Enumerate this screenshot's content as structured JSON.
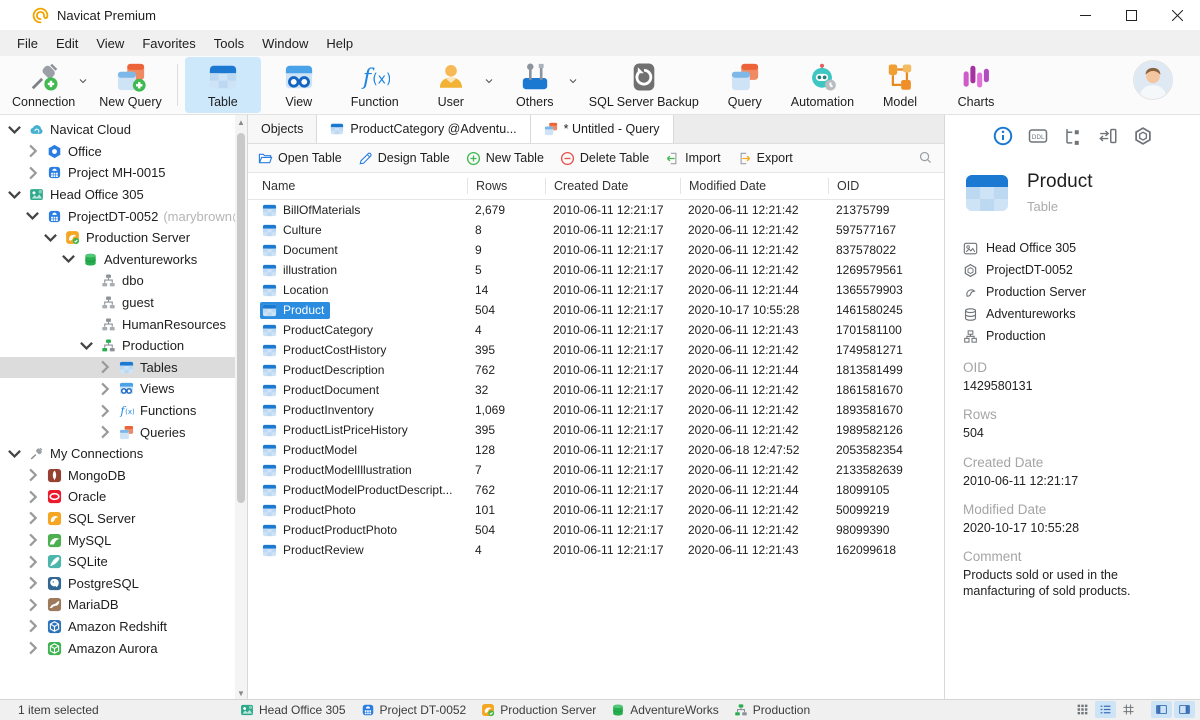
{
  "window": {
    "title": "Navicat Premium"
  },
  "menu": [
    "File",
    "Edit",
    "View",
    "Favorites",
    "Tools",
    "Window",
    "Help"
  ],
  "toolbar": {
    "items": [
      {
        "label": "Connection",
        "icon": "connection",
        "dropdown": true
      },
      {
        "label": "New Query",
        "icon": "new-query"
      },
      {
        "type": "separator"
      },
      {
        "label": "Table",
        "icon": "table",
        "active": true
      },
      {
        "label": "View",
        "icon": "view"
      },
      {
        "label": "Function",
        "icon": "function"
      },
      {
        "label": "User",
        "icon": "user",
        "dropdown": true
      },
      {
        "label": "Others",
        "icon": "others",
        "dropdown": true
      },
      {
        "label": "SQL Server Backup",
        "icon": "backup"
      },
      {
        "label": "Query",
        "icon": "query"
      },
      {
        "label": "Automation",
        "icon": "automation"
      },
      {
        "label": "Model",
        "icon": "model"
      },
      {
        "label": "Charts",
        "icon": "charts"
      }
    ]
  },
  "tabs": [
    {
      "label": "Objects",
      "active": true
    },
    {
      "label": "ProductCategory @Adventu...",
      "icon": "table"
    },
    {
      "label": "* Untitled - Query",
      "icon": "query"
    }
  ],
  "object_toolbar": [
    {
      "label": "Open Table",
      "icon": "open-table"
    },
    {
      "label": "Design Table",
      "icon": "design-table"
    },
    {
      "label": "New Table",
      "icon": "new-table"
    },
    {
      "label": "Delete Table",
      "icon": "delete-table"
    },
    {
      "label": "Import",
      "icon": "import"
    },
    {
      "label": "Export",
      "icon": "export"
    }
  ],
  "sidebar": {
    "items": [
      {
        "label": "Navicat Cloud",
        "icon": "cloud",
        "level": 0,
        "arrow": "open"
      },
      {
        "label": "Office",
        "icon": "office",
        "level": 1,
        "arrow": "closed"
      },
      {
        "label": "Project MH-0015",
        "icon": "project",
        "level": 1,
        "arrow": "closed"
      },
      {
        "label": "Head Office 305",
        "icon": "head-office",
        "level": 0,
        "arrow": "open"
      },
      {
        "label": "ProjectDT-0052",
        "suffix": "(marybrown@",
        "icon": "project",
        "level": 1,
        "arrow": "open"
      },
      {
        "label": "Production Server",
        "icon": "server",
        "level": 2,
        "arrow": "open"
      },
      {
        "label": "Adventureworks",
        "icon": "database",
        "level": 3,
        "arrow": "open"
      },
      {
        "label": "dbo",
        "icon": "schema",
        "level": 4,
        "arrow": "none"
      },
      {
        "label": "guest",
        "icon": "schema",
        "level": 4,
        "arrow": "none"
      },
      {
        "label": "HumanResources",
        "icon": "schema",
        "level": 4,
        "arrow": "none"
      },
      {
        "label": "Production",
        "icon": "schema-active",
        "level": 4,
        "arrow": "open"
      },
      {
        "label": "Tables",
        "icon": "table",
        "level": 5,
        "arrow": "closed",
        "selected": true
      },
      {
        "label": "Views",
        "icon": "view",
        "level": 5,
        "arrow": "closed"
      },
      {
        "label": "Functions",
        "icon": "function",
        "level": 5,
        "arrow": "closed"
      },
      {
        "label": "Queries",
        "icon": "query",
        "level": 5,
        "arrow": "closed"
      },
      {
        "label": "My Connections",
        "icon": "connections",
        "level": 0,
        "arrow": "open"
      },
      {
        "label": "MongoDB",
        "icon": "mongodb",
        "level": 1,
        "arrow": "closed"
      },
      {
        "label": "Oracle",
        "icon": "oracle",
        "level": 1,
        "arrow": "closed"
      },
      {
        "label": "SQL Server",
        "icon": "sqlserver",
        "level": 1,
        "arrow": "closed"
      },
      {
        "label": "MySQL",
        "icon": "mysql",
        "level": 1,
        "arrow": "closed"
      },
      {
        "label": "SQLite",
        "icon": "sqlite",
        "level": 1,
        "arrow": "closed"
      },
      {
        "label": "PostgreSQL",
        "icon": "postgresql",
        "level": 1,
        "arrow": "closed"
      },
      {
        "label": "MariaDB",
        "icon": "mariadb",
        "level": 1,
        "arrow": "closed"
      },
      {
        "label": "Amazon Redshift",
        "icon": "redshift",
        "level": 1,
        "arrow": "closed"
      },
      {
        "label": "Amazon Aurora",
        "icon": "aurora",
        "level": 1,
        "arrow": "closed"
      }
    ]
  },
  "table": {
    "columns": [
      "Name",
      "Rows",
      "Created Date",
      "Modified Date",
      "OID"
    ],
    "selected_index": 5,
    "rows": [
      [
        "BillOfMaterials",
        "2,679",
        "2010-06-11 12:21:17",
        "2020-06-11 12:21:42",
        "21375799"
      ],
      [
        "Culture",
        "8",
        "2010-06-11 12:21:17",
        "2020-06-11 12:21:42",
        "597577167"
      ],
      [
        "Document",
        "9",
        "2010-06-11 12:21:17",
        "2020-06-11 12:21:42",
        "837578022"
      ],
      [
        "illustration",
        "5",
        "2010-06-11 12:21:17",
        "2020-06-11 12:21:42",
        "1269579561"
      ],
      [
        "Location",
        "14",
        "2010-06-11 12:21:17",
        "2020-06-11 12:21:44",
        "1365579903"
      ],
      [
        "Product",
        "504",
        "2010-06-11 12:21:17",
        "2020-10-17 10:55:28",
        "1461580245"
      ],
      [
        "ProductCategory",
        "4",
        "2010-06-11 12:21:17",
        "2020-06-11 12:21:43",
        "1701581100"
      ],
      [
        "ProductCostHistory",
        "395",
        "2010-06-11 12:21:17",
        "2020-06-11 12:21:42",
        "1749581271"
      ],
      [
        "ProductDescription",
        "762",
        "2010-06-11 12:21:17",
        "2020-06-11 12:21:44",
        "1813581499"
      ],
      [
        "ProductDocument",
        "32",
        "2010-06-11 12:21:17",
        "2020-06-11 12:21:42",
        "1861581670"
      ],
      [
        "ProductInventory",
        "1,069",
        "2010-06-11 12:21:17",
        "2020-06-11 12:21:42",
        "1893581670"
      ],
      [
        "ProductListPriceHistory",
        "395",
        "2010-06-11 12:21:17",
        "2020-06-11 12:21:42",
        "1989582126"
      ],
      [
        "ProductModel",
        "128",
        "2010-06-11 12:21:17",
        "2020-06-18 12:47:52",
        "2053582354"
      ],
      [
        "ProductModelIllustration",
        "7",
        "2010-06-11 12:21:17",
        "2020-06-11 12:21:42",
        "2133582639"
      ],
      [
        "ProductModelProductDescript...",
        "762",
        "2010-06-11 12:21:17",
        "2020-06-11 12:21:44",
        "18099105"
      ],
      [
        "ProductPhoto",
        "101",
        "2010-06-11 12:21:17",
        "2020-06-11 12:21:42",
        "50099219"
      ],
      [
        "ProductProductPhoto",
        "504",
        "2010-06-11 12:21:17",
        "2020-06-11 12:21:42",
        "98099390"
      ],
      [
        "ProductReview",
        "4",
        "2010-06-11 12:21:17",
        "2020-06-11 12:21:43",
        "162099618"
      ]
    ]
  },
  "details": {
    "nav_icons": [
      {
        "name": "info",
        "active": true
      },
      {
        "name": "ddl"
      },
      {
        "name": "related-objects"
      },
      {
        "name": "dependency"
      },
      {
        "name": "maintain"
      }
    ],
    "title": "Product",
    "subtitle": "Table",
    "path": [
      {
        "icon": "gray-head-office",
        "label": "Head Office 305"
      },
      {
        "icon": "gray-hexagon",
        "label": "ProjectDT-0052"
      },
      {
        "icon": "gray-server",
        "label": "Production Server"
      },
      {
        "icon": "gray-database",
        "label": "Adventureworks"
      },
      {
        "icon": "gray-schema",
        "label": "Production"
      }
    ],
    "fields": [
      {
        "label": "OID",
        "value": "1429580131"
      },
      {
        "label": "Rows",
        "value": "504"
      },
      {
        "label": "Created Date",
        "value": "2010-06-11 12:21:17"
      },
      {
        "label": "Modified Date",
        "value": "2020-10-17 10:55:28"
      },
      {
        "label": "Comment",
        "value": "Products sold or used in the manfacturing of sold products."
      }
    ]
  },
  "status": {
    "left": "1 item selected",
    "path": [
      {
        "icon": "head-office",
        "label": "Head Office 305"
      },
      {
        "icon": "project",
        "label": "Project DT-0052"
      },
      {
        "icon": "server",
        "label": "Production Server"
      },
      {
        "icon": "database",
        "label": "AdventureWorks"
      },
      {
        "icon": "schema-active",
        "label": "Production"
      }
    ],
    "view_buttons": [
      {
        "name": "large-icons-view",
        "icon": "large-icons"
      },
      {
        "name": "list-view",
        "icon": "list-view",
        "selected": true
      },
      {
        "name": "detail-view",
        "icon": "detail-view"
      },
      {
        "name": "gap"
      },
      {
        "name": "toggle-left-panel",
        "icon": "panel-left",
        "selected": true
      },
      {
        "name": "toggle-right-panel",
        "icon": "panel-right",
        "selected": true
      }
    ]
  }
}
